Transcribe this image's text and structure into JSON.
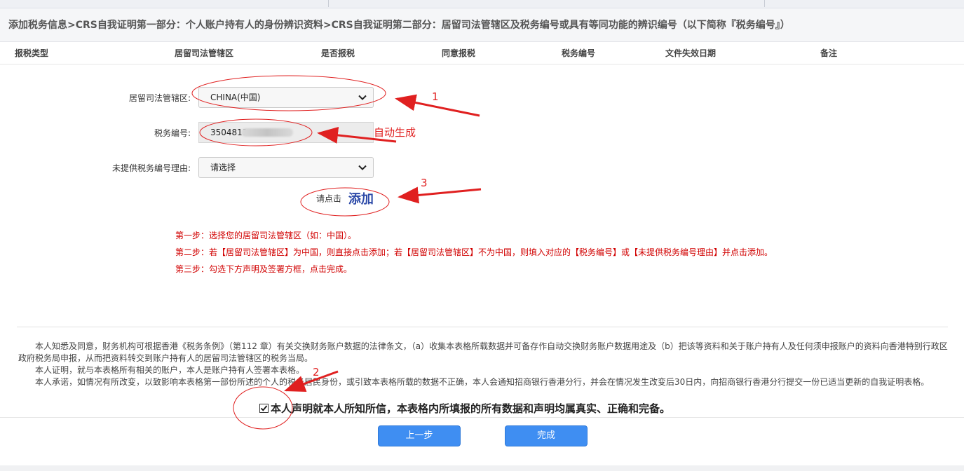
{
  "breadcrumb": "添加税务信息>CRS自我证明第一部分：个人账户持有人的身份辨识资料>CRS自我证明第二部分：居留司法管辖区及税务编号或具有等同功能的辨识编号（以下简称『税务编号』）",
  "table_headers": [
    "报税类型",
    "居留司法管辖区",
    "是否报税",
    "同意报税",
    "税务编号",
    "文件失效日期",
    "备注"
  ],
  "form": {
    "jurisdiction_label": "居留司法管辖区:",
    "jurisdiction_value": "CHINA(中国)",
    "tax_no_label": "税务编号:",
    "tax_no_value": "3504811",
    "reason_label": "未提供税务编号理由:",
    "reason_value": "请选择",
    "add_prefix": "请点击",
    "add_label": "添加"
  },
  "steps": [
    "第一步：选择您的居留司法管辖区（如：中国）。",
    "第二步：若【居留司法管辖区】为中国，则直接点击添加；若【居留司法管辖区】不为中国，则填入对应的【税务编号】或【未提供税务编号理由】并点击添加。",
    "第三步：勾选下方声明及签署方框，点击完成。"
  ],
  "declaration": [
    "本人知悉及同意，财务机构可根据香港《税务条例》（第112 章）有关交换财务账户数据的法律条文，（a）收集本表格所载数据并可备存作自动交换财务账户数据用途及（b）把该等资料和关于账户持有人及任何须申报账户的资料向香港特别行政区政府税务局申报，从而把资料转交到账户持有人的居留司法管辖区的税务当局。",
    "本人证明，就与本表格所有相关的账户，本人是账户持有人签署本表格。",
    "本人承诺，如情况有所改变，以致影响本表格第一部份所述的个人的税务居民身份，或引致本表格所载的数据不正确，本人会通知招商银行香港分行，并会在情况发生改变后30日内，向招商银行香港分行提交一份已适当更新的自我证明表格。"
  ],
  "confirm_text": "本人声明就本人所知所信，本表格内所填报的所有数据和声明均属真实、正确和完备。",
  "confirm_checked": true,
  "buttons": {
    "prev": "上一步",
    "finish": "完成"
  },
  "annotations": {
    "n1": "1",
    "auto": "自动生成",
    "n3": "3",
    "n2": "2"
  },
  "colors": {
    "annotation": "#e02020",
    "button": "#3f8ef2",
    "steps": "#d10000",
    "add": "#2d4aa8"
  },
  "icons": {
    "dropdown": "chevron-down-icon",
    "checkbox": "checkmark-icon"
  }
}
